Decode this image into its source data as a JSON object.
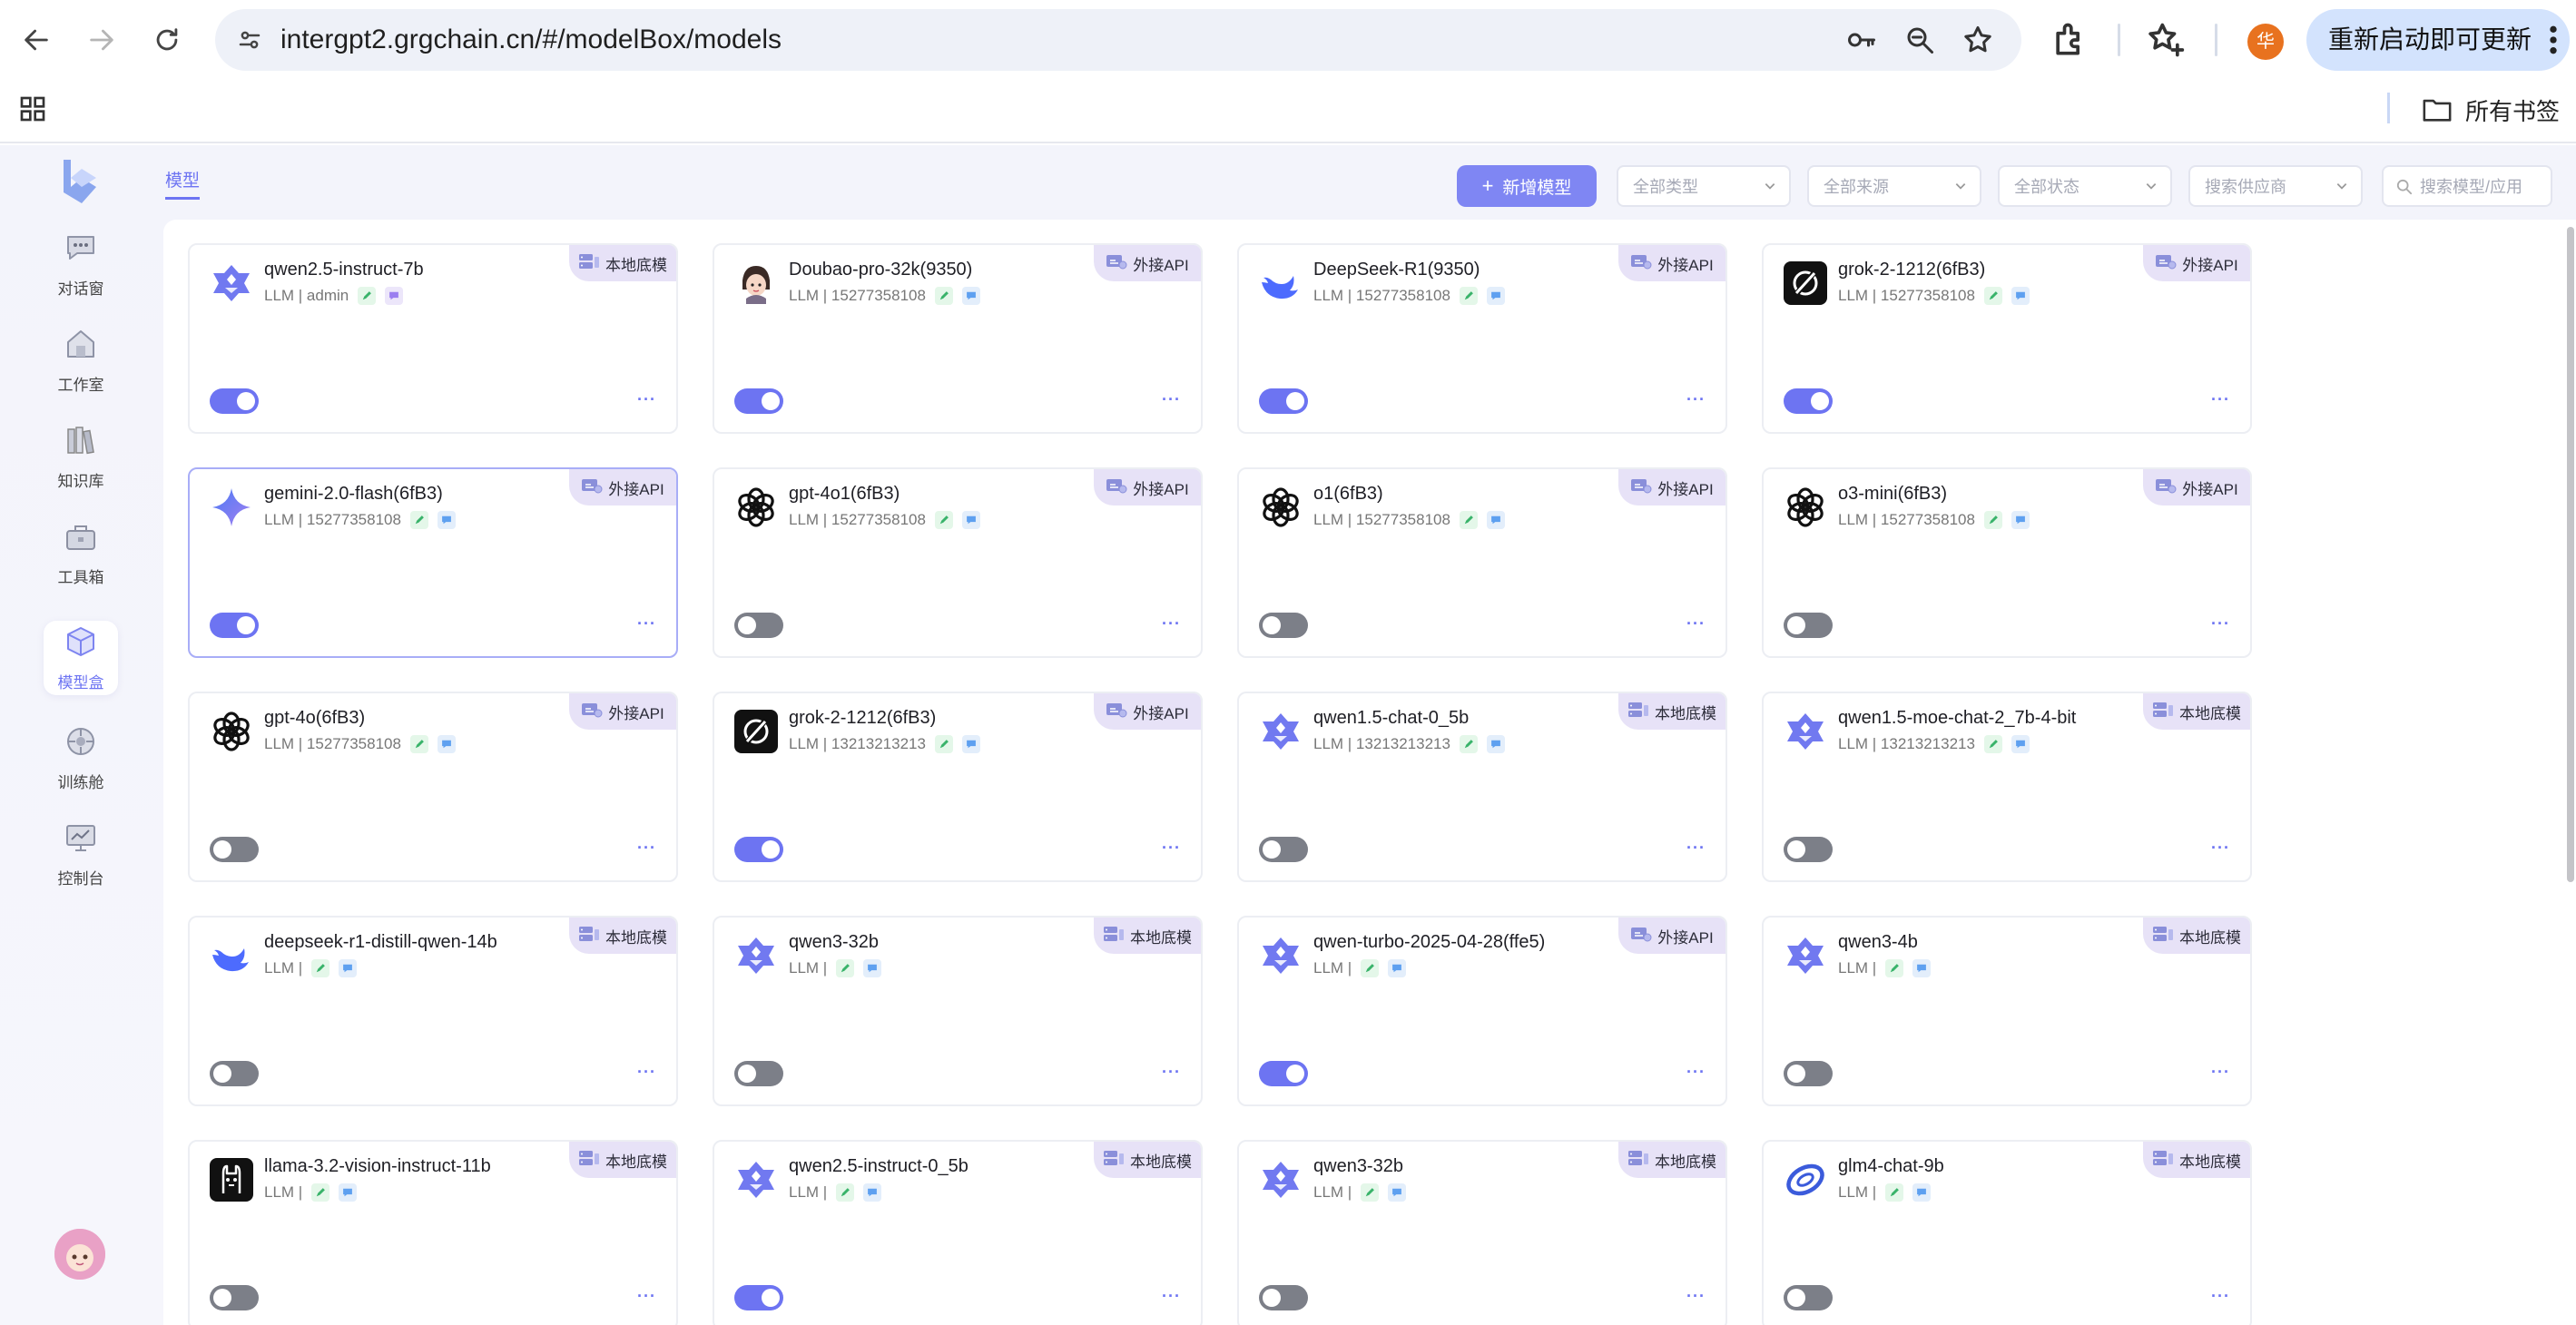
{
  "browser": {
    "url": "intergpt2.grgchain.cn/#/modelBox/models",
    "profile_initial": "华",
    "relaunch_label": "重新启动即可更新",
    "all_bookmarks_label": "所有书签"
  },
  "sidebar": {
    "items": [
      {
        "label": "对话窗",
        "icon": "chat-icon"
      },
      {
        "label": "工作室",
        "icon": "studio-icon"
      },
      {
        "label": "知识库",
        "icon": "books-icon"
      },
      {
        "label": "工具箱",
        "icon": "toolbox-icon"
      },
      {
        "label": "模型盒",
        "icon": "model-box-icon",
        "active": true
      },
      {
        "label": "训练舱",
        "icon": "training-icon"
      },
      {
        "label": "控制台",
        "icon": "console-icon"
      }
    ]
  },
  "header": {
    "tab_label": "模型",
    "add_label": "新增模型",
    "filters": [
      "全部类型",
      "全部来源",
      "全部状态",
      "搜索供应商"
    ],
    "search_placeholder": "搜索模型/应用"
  },
  "models": [
    {
      "name": "qwen2.5-instruct-7b",
      "meta": "LLM | admin",
      "source": "本地底模",
      "icon": "qwen-icon",
      "enabled": true
    },
    {
      "name": "Doubao-pro-32k(9350)",
      "meta": "LLM | 15277358108",
      "source": "外接API",
      "icon": "doubao-icon",
      "enabled": true
    },
    {
      "name": "DeepSeek-R1(9350)",
      "meta": "LLM | 15277358108",
      "source": "外接API",
      "icon": "deepseek-icon",
      "enabled": true
    },
    {
      "name": "grok-2-1212(6fB3)",
      "meta": "LLM | 15277358108",
      "source": "外接API",
      "icon": "grok-icon",
      "enabled": true
    },
    {
      "name": "gemini-2.0-flash(6fB3)",
      "meta": "LLM | 15277358108",
      "source": "外接API",
      "icon": "gemini-icon",
      "enabled": true
    },
    {
      "name": "gpt-4o1(6fB3)",
      "meta": "LLM | 15277358108",
      "source": "外接API",
      "icon": "openai-icon",
      "enabled": false
    },
    {
      "name": "o1(6fB3)",
      "meta": "LLM | 15277358108",
      "source": "外接API",
      "icon": "openai-icon",
      "enabled": false
    },
    {
      "name": "o3-mini(6fB3)",
      "meta": "LLM | 15277358108",
      "source": "外接API",
      "icon": "openai-icon",
      "enabled": false
    },
    {
      "name": "gpt-4o(6fB3)",
      "meta": "LLM | 15277358108",
      "source": "外接API",
      "icon": "openai-icon",
      "enabled": false
    },
    {
      "name": "grok-2-1212(6fB3)",
      "meta": "LLM | 13213213213",
      "source": "外接API",
      "icon": "grok-icon",
      "enabled": true
    },
    {
      "name": "qwen1.5-chat-0_5b",
      "meta": "LLM | 13213213213",
      "source": "本地底模",
      "icon": "qwen-icon",
      "enabled": false
    },
    {
      "name": "qwen1.5-moe-chat-2_7b-4-bit",
      "meta": "LLM | 13213213213",
      "source": "本地底模",
      "icon": "qwen-icon",
      "enabled": false
    },
    {
      "name": "deepseek-r1-distill-qwen-14b",
      "meta": "LLM |",
      "source": "本地底模",
      "icon": "deepseek-icon",
      "enabled": false
    },
    {
      "name": "qwen3-32b",
      "meta": "LLM |",
      "source": "本地底模",
      "icon": "qwen-icon",
      "enabled": false
    },
    {
      "name": "qwen-turbo-2025-04-28(ffe5)",
      "meta": "LLM |",
      "source": "外接API",
      "icon": "qwen-icon",
      "enabled": true
    },
    {
      "name": "qwen3-4b",
      "meta": "LLM |",
      "source": "本地底模",
      "icon": "qwen-icon",
      "enabled": false
    },
    {
      "name": "llama-3.2-vision-instruct-11b",
      "meta": "LLM |",
      "source": "本地底模",
      "icon": "llama-icon",
      "enabled": false
    },
    {
      "name": "qwen2.5-instruct-0_5b",
      "meta": "LLM |",
      "source": "本地底模",
      "icon": "qwen-icon",
      "enabled": true
    },
    {
      "name": "qwen3-32b",
      "meta": "LLM |",
      "source": "本地底模",
      "icon": "qwen-icon",
      "enabled": false
    },
    {
      "name": "glm4-chat-9b",
      "meta": "LLM |",
      "source": "本地底模",
      "icon": "glm-icon",
      "enabled": false
    }
  ],
  "more_label": "···",
  "colors": {
    "accent": "#6d74f2",
    "badge_bg": "#e7e2f7",
    "toggle_off": "#7c7f88"
  }
}
